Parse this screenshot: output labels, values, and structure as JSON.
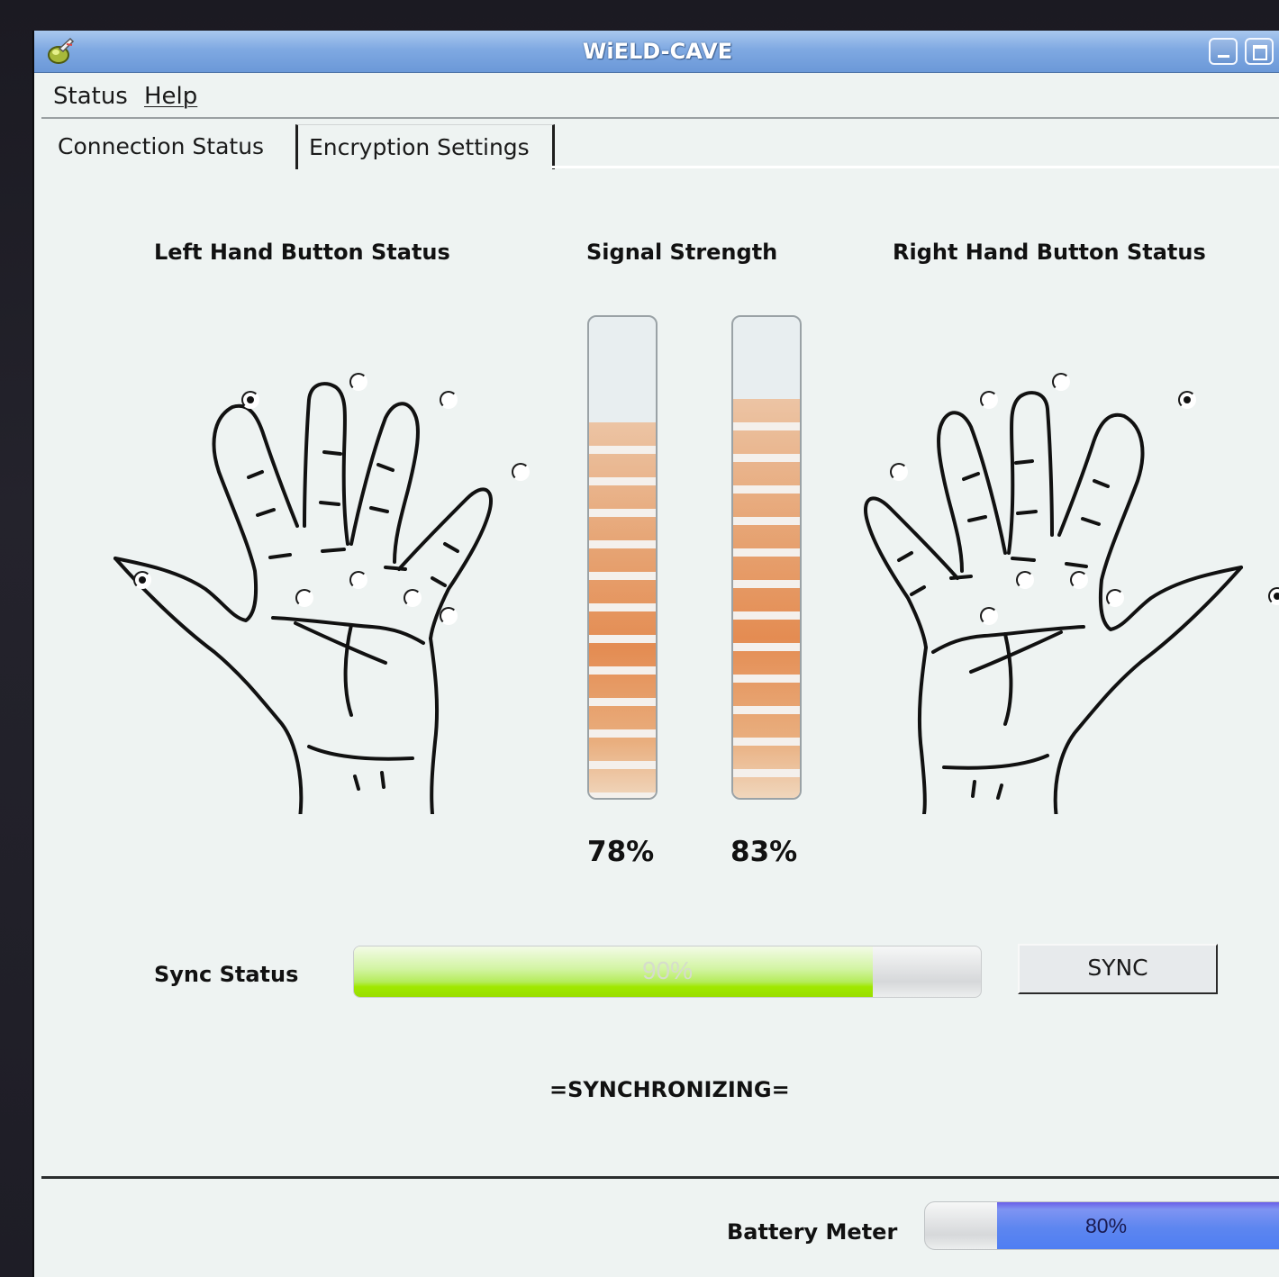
{
  "window": {
    "title": "WiELD-CAVE"
  },
  "menubar": {
    "items": [
      {
        "label": "Status"
      },
      {
        "label": "Help"
      }
    ]
  },
  "tabs": [
    {
      "label": "Connection Status",
      "active": true
    },
    {
      "label": "Encryption Settings",
      "active": false
    }
  ],
  "left_hand": {
    "title": "Left Hand Button Status",
    "buttons": [
      {
        "id": "index-tip",
        "on": true
      },
      {
        "id": "middle-tip",
        "on": false
      },
      {
        "id": "ring-tip",
        "on": false
      },
      {
        "id": "pinky-tip",
        "on": false
      },
      {
        "id": "thumb-tip",
        "on": true
      },
      {
        "id": "index-base",
        "on": false
      },
      {
        "id": "middle-base",
        "on": false
      },
      {
        "id": "ring-base",
        "on": false
      },
      {
        "id": "pinky-base",
        "on": false
      }
    ]
  },
  "right_hand": {
    "title": "Right Hand Button Status",
    "buttons": [
      {
        "id": "pinky-tip",
        "on": false
      },
      {
        "id": "ring-tip",
        "on": false
      },
      {
        "id": "middle-tip",
        "on": false
      },
      {
        "id": "index-tip",
        "on": true
      },
      {
        "id": "thumb-tip",
        "on": true
      },
      {
        "id": "pinky-base",
        "on": false
      },
      {
        "id": "ring-base",
        "on": false
      },
      {
        "id": "middle-base",
        "on": false
      },
      {
        "id": "index-base",
        "on": false
      }
    ]
  },
  "signal": {
    "title": "Signal Strength",
    "meters": [
      {
        "value": 0.78,
        "label": "78%"
      },
      {
        "value": 0.83,
        "label": "83%"
      }
    ]
  },
  "sync": {
    "label": "Sync Status",
    "progress": 0.9,
    "progress_text": "90%",
    "button_label": "SYNC",
    "message": "=SYNCHRONIZING="
  },
  "battery": {
    "label": "Battery Meter",
    "progress": 0.8,
    "progress_text": "80%"
  },
  "colors": {
    "titlebar": "#7fa9e2",
    "signal_fill": "#e48c52",
    "sync_fill": "#9ade00",
    "battery_fill": "#5d86f0",
    "window_bg": "#eef3f2"
  }
}
